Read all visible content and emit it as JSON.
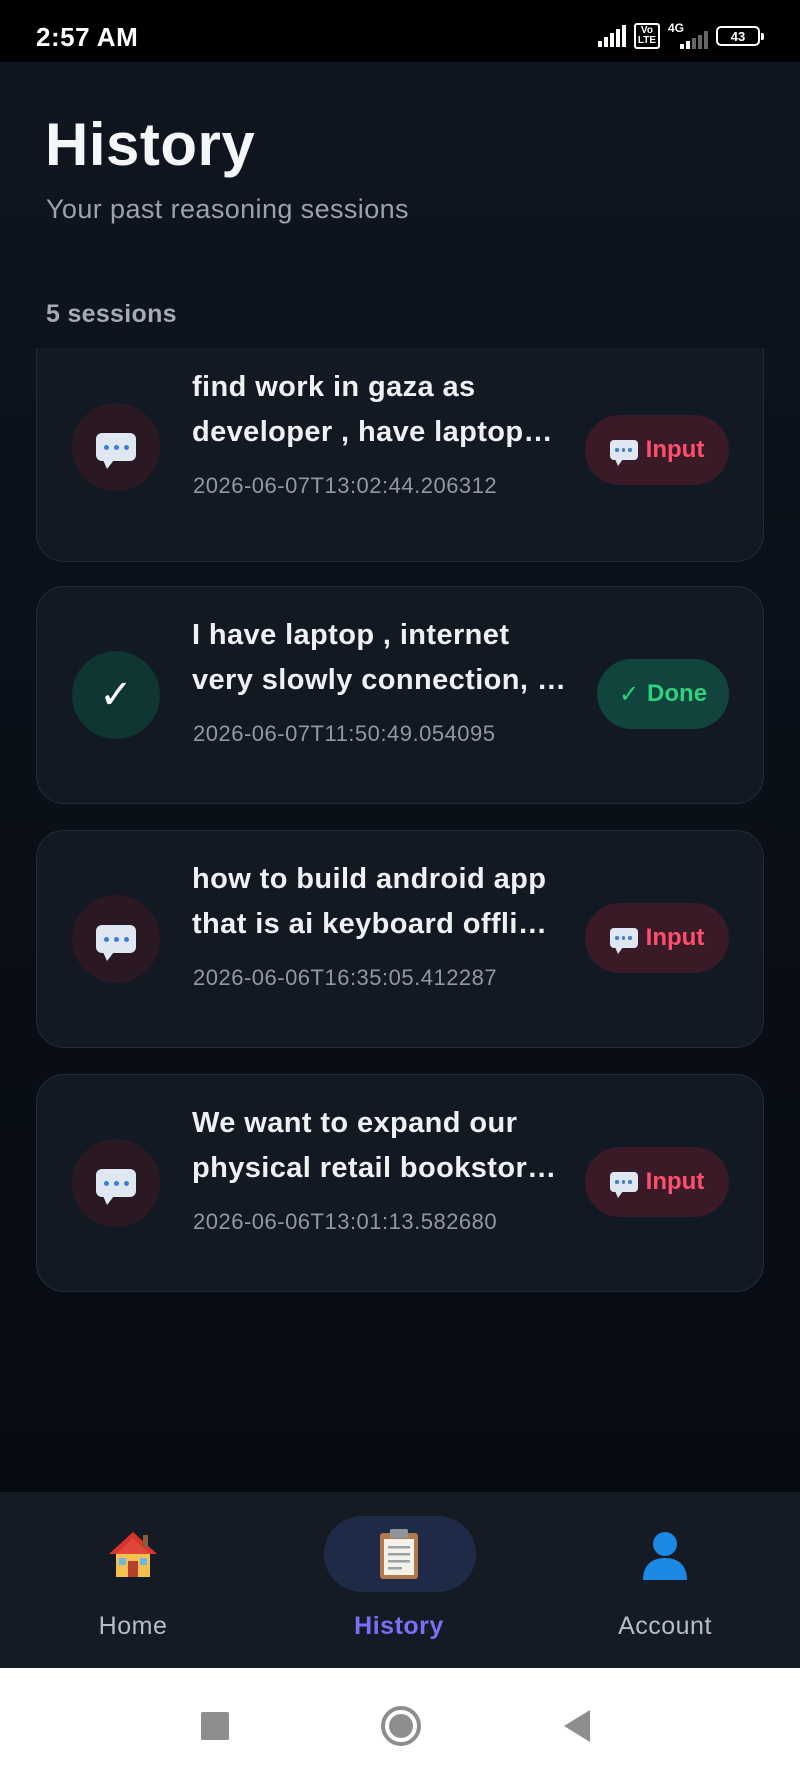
{
  "status_bar": {
    "time": "2:57 AM",
    "volte": "Vo\nLTE",
    "network": "4G",
    "battery": "43"
  },
  "header": {
    "title": "History",
    "subtitle": "Your past reasoning sessions"
  },
  "session_count": "5 sessions",
  "sessions": [
    {
      "title": "find work in gaza as\ndeveloper , have laptop…",
      "timestamp": "2026-06-07T13:02:44.206312",
      "status": "Input",
      "icon": "chat-bubble-icon"
    },
    {
      "title": "I have laptop , internet\nvery slowly connection, …",
      "timestamp": "2026-06-07T11:50:49.054095",
      "status": "Done",
      "icon": "check-icon"
    },
    {
      "title": "how to build android app\nthat is ai keyboard offli…",
      "timestamp": "2026-06-06T16:35:05.412287",
      "status": "Input",
      "icon": "chat-bubble-icon"
    },
    {
      "title": "We want to expand our\nphysical retail bookstor…",
      "timestamp": "2026-06-06T13:01:13.582680",
      "status": "Input",
      "icon": "chat-bubble-icon"
    }
  ],
  "bottom_nav": {
    "items": [
      {
        "label": "Home",
        "icon": "house-icon",
        "active": false
      },
      {
        "label": "History",
        "icon": "clipboard-icon",
        "active": true
      },
      {
        "label": "Account",
        "icon": "person-icon",
        "active": false
      }
    ]
  },
  "colors": {
    "input_badge_text": "#ff4f6e",
    "done_badge_text": "#2fd17f",
    "active_nav": "#7c6ff5"
  }
}
